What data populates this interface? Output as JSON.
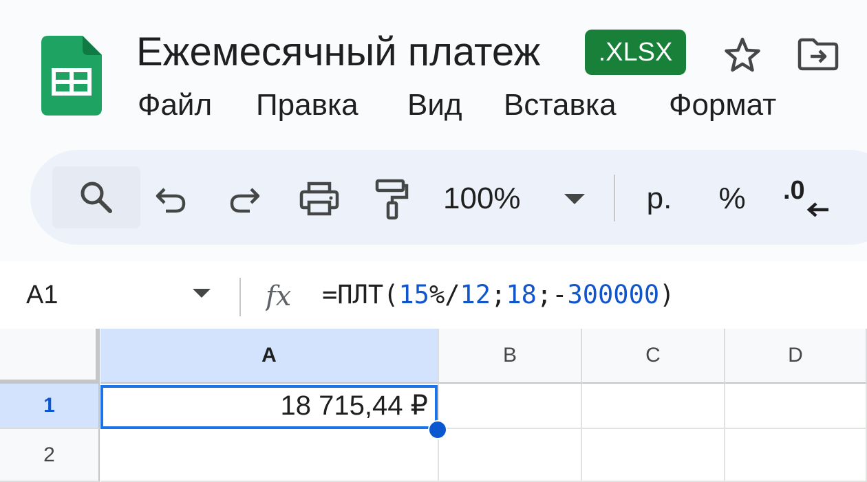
{
  "header": {
    "title": "Ежемесячный платеж",
    "file_badge": ".XLSX",
    "logo_icon": "sheets-logo-icon",
    "star_icon": "star-icon",
    "move_icon": "move-to-folder-icon"
  },
  "menu": {
    "items": [
      "Файл",
      "Правка",
      "Вид",
      "Вставка",
      "Формат"
    ]
  },
  "toolbar": {
    "zoom": "100%",
    "currency_label": "р.",
    "percent_label": "%",
    "decrease_decimal_label": ".0",
    "icons": [
      "search-icon",
      "undo-icon",
      "redo-icon",
      "print-icon",
      "paint-format-icon",
      "chevron-down-icon",
      "arrow-left-icon"
    ]
  },
  "formula_bar": {
    "cell_ref": "A1",
    "fx_label": "fx",
    "formula_parts": {
      "p1": "=ПЛТ(",
      "p2": "15",
      "p3": "%/",
      "p4": "12",
      "p5": ";",
      "p6": "18",
      "p7": ";-",
      "p8": "300000",
      "p9": ")"
    }
  },
  "grid": {
    "columns": [
      "A",
      "B",
      "C",
      "D"
    ],
    "rows": [
      "1",
      "2"
    ],
    "cells": {
      "A1": "18 715,44 ₽"
    },
    "selected": "A1"
  },
  "colors": {
    "accent": "#1a73e8",
    "badge": "#188038",
    "formula_number": "#1155cc",
    "selected_header": "#d3e3fd"
  }
}
